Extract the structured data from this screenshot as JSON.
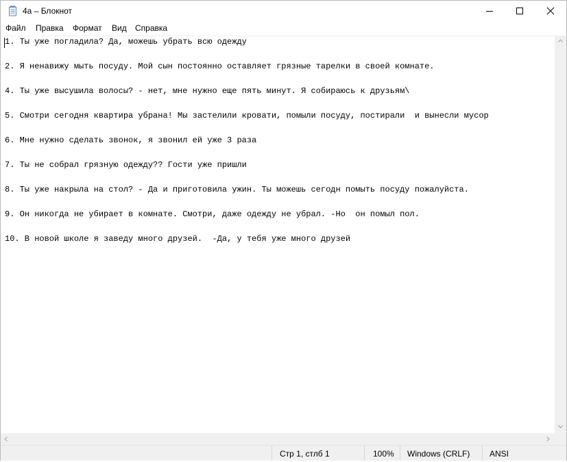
{
  "window": {
    "title": "4a – Блокнот",
    "icon": "notepad-icon"
  },
  "window_controls": {
    "minimize_icon": "minimize-icon",
    "maximize_icon": "maximize-icon",
    "close_icon": "close-icon"
  },
  "menu": {
    "items": [
      "Файл",
      "Правка",
      "Формат",
      "Вид",
      "Справка"
    ]
  },
  "editor": {
    "lines": [
      "1. Ты уже погладила? Да, можешь убрать всю одежду",
      "",
      "2. Я ненавижу мыть посуду. Мой сын постоянно оставляет грязные тарелки в своей комнате.",
      "",
      "4. Ты уже высушила волосы? - нет, мне нужно еще пять минут. Я собираюсь к друзьям\\",
      "",
      "5. Смотри сегодня квартира убрана! Мы застелили кровати, помыли посуду, постирали  и вынесли мусор",
      "",
      "6. Мне нужно сделать звонок, я звонил ей уже 3 раза",
      "",
      "7. Ты не собрал грязную одежду?? Гости уже пришли",
      "",
      "8. Ты уже накрыла на стол? - Да и приготовила ужин. Ты можешь сегодн помыть посуду пожалуйста.",
      "",
      "9. Он никогда не убирает в комнате. Смотри, даже одежду не убрал. -Но  он помыл пол.",
      "",
      "10. В новой школе я заведу много друзей.  -Да, у тебя уже много друзей"
    ]
  },
  "statusbar": {
    "position": "Стр 1, стлб 1",
    "zoom": "100%",
    "line_endings": "Windows (CRLF)",
    "encoding": "ANSI"
  }
}
